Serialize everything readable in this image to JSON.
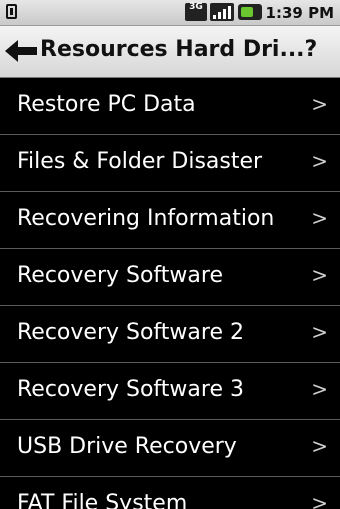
{
  "status_bar": {
    "network_badge": "3G",
    "time": "1:39 PM"
  },
  "title_bar": {
    "title": "Resources Hard Dri...?"
  },
  "list": {
    "items": [
      {
        "label": "Restore PC Data",
        "chevron": ">"
      },
      {
        "label": "Files & Folder Disaster",
        "chevron": ">"
      },
      {
        "label": "Recovering Information",
        "chevron": ">"
      },
      {
        "label": "Recovery Software",
        "chevron": ">"
      },
      {
        "label": "Recovery Software 2",
        "chevron": ">"
      },
      {
        "label": "Recovery Software 3",
        "chevron": ">"
      },
      {
        "label": "USB Drive Recovery",
        "chevron": ">"
      },
      {
        "label": "FAT File System",
        "chevron": ">"
      }
    ]
  },
  "colors": {
    "background": "#000000",
    "title_bar": "#e0e0e0",
    "item_text": "#ffffff",
    "battery": "#6ac72f"
  }
}
